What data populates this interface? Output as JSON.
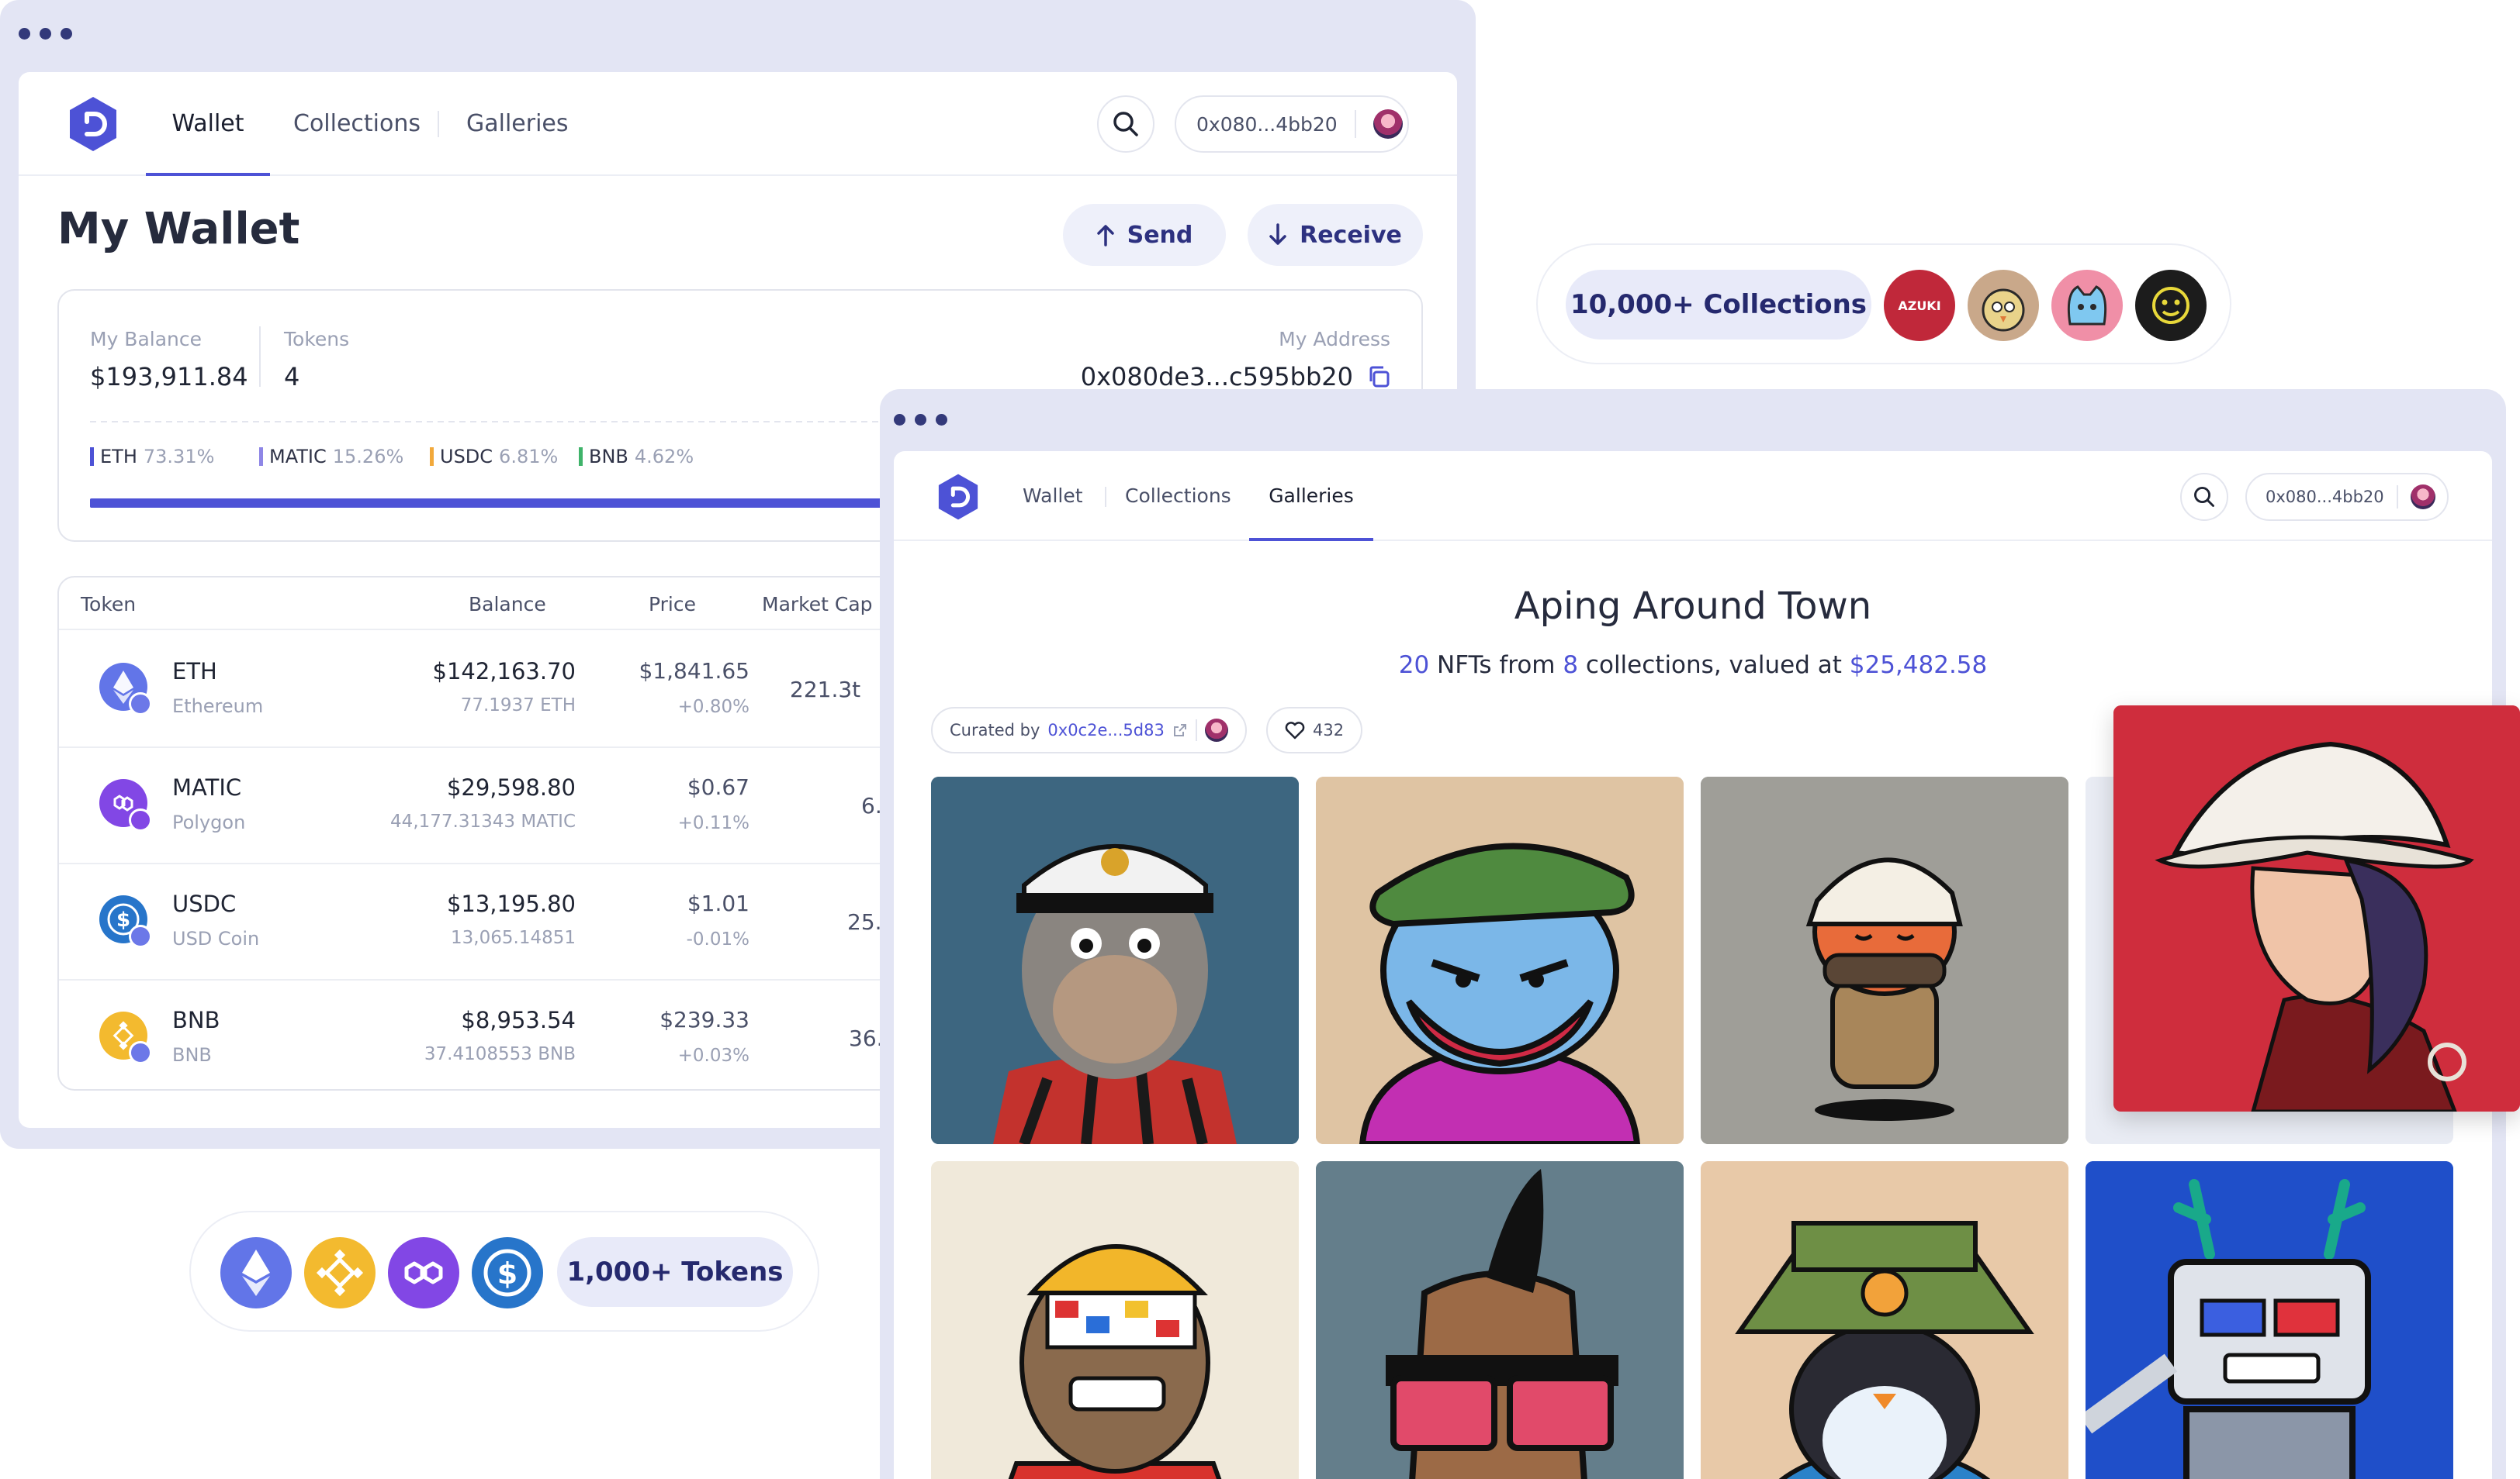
{
  "wallet_window": {
    "nav": {
      "tabs": [
        {
          "label": "Wallet",
          "active": true
        },
        {
          "label": "Collections",
          "active": false
        },
        {
          "label": "Galleries",
          "active": false
        }
      ],
      "address": "0x080...4bb20"
    },
    "title": "My Wallet",
    "actions": {
      "send": "Send",
      "receive": "Receive"
    },
    "summary": {
      "balance_label": "My Balance",
      "balance_value": "$193,911.84",
      "tokens_label": "Tokens",
      "tokens_value": "4",
      "address_label": "My Address",
      "address_value": "0x080de3...c595bb20",
      "allocation": [
        {
          "name": "ETH",
          "percent": "73.31%",
          "color": "#4d52d6"
        },
        {
          "name": "MATIC",
          "percent": "15.26%",
          "color": "#8e86e6"
        },
        {
          "name": "USDC",
          "percent": "6.81%",
          "color": "#f2a93b"
        },
        {
          "name": "BNB",
          "percent": "4.62%",
          "color": "#3fb36a"
        }
      ],
      "allocation_bar": {
        "filled_percent": 73.31
      }
    },
    "table": {
      "headers": {
        "token": "Token",
        "balance": "Balance",
        "price": "Price",
        "market_cap": "Market Cap"
      },
      "rows": [
        {
          "symbol": "ETH",
          "name": "Ethereum",
          "balance_usd": "$142,163.70",
          "balance_token": "77.1937 ETH",
          "price": "$1,841.65",
          "change": "+0.80%",
          "market_cap": "221.3t",
          "icon": "eth-icon",
          "color": "#6275e8"
        },
        {
          "symbol": "MATIC",
          "name": "Polygon",
          "balance_usd": "$29,598.80",
          "balance_token": "44,177.31343 MATIC",
          "price": "$0.67",
          "change": "+0.11%",
          "market_cap": "6.3t",
          "icon": "matic-icon",
          "color": "#8247e5"
        },
        {
          "symbol": "USDC",
          "name": "USD Coin",
          "balance_usd": "$13,195.80",
          "balance_token": "13,065.14851",
          "price": "$1.01",
          "change": "-0.01%",
          "market_cap": "25.9t",
          "icon": "usdc-icon",
          "color": "#2775ca"
        },
        {
          "symbol": "BNB",
          "name": "BNB",
          "balance_usd": "$8,953.54",
          "balance_token": "37.4108553 BNB",
          "price": "$239.33",
          "change": "+0.03%",
          "market_cap": "36.8t",
          "icon": "bnb-icon",
          "color": "#f3ba2f"
        }
      ]
    }
  },
  "collections_badge": {
    "label": "10,000+ Collections",
    "logos": [
      {
        "name": "azuki-logo",
        "text": "AZUKI",
        "color": "#c0283a"
      },
      {
        "name": "bird-pfp-logo",
        "color": "#c9a88a"
      },
      {
        "name": "cool-cat-logo",
        "color": "#f08fa7"
      },
      {
        "name": "smiley-logo",
        "color": "#1c1c1c"
      }
    ]
  },
  "tokens_badge": {
    "label": "1,000+ Tokens",
    "icons": [
      {
        "name": "eth-icon",
        "color": "#6275e8"
      },
      {
        "name": "bnb-icon",
        "color": "#f3ba2f"
      },
      {
        "name": "matic-icon",
        "color": "#8247e5"
      },
      {
        "name": "usdc-icon",
        "color": "#2775ca"
      }
    ]
  },
  "gallery_window": {
    "nav": {
      "tabs": [
        {
          "label": "Wallet",
          "active": false
        },
        {
          "label": "Collections",
          "active": false
        },
        {
          "label": "Galleries",
          "active": true
        }
      ],
      "address": "0x080...4bb20"
    },
    "title": "Aping Around Town",
    "subtitle": {
      "nft_count": "20",
      "text_a": " NFTs from ",
      "collection_count": "8",
      "text_b": " collections, valued at ",
      "value": "$25,482.58"
    },
    "curated": {
      "prefix": "Curated by",
      "address": "0x0c2e...5d83"
    },
    "likes": "432",
    "nfts": [
      {
        "name": "nft-ape-captain",
        "bg": "#3d6680"
      },
      {
        "name": "nft-bird-beret",
        "bg": "#dfc4a3"
      },
      {
        "name": "nft-orange-cap",
        "bg": "#9f9e98"
      },
      {
        "name": "nft-hidden",
        "bg": "#e9ecf4"
      },
      {
        "name": "nft-ape-beanie",
        "bg": "#f0e9da"
      },
      {
        "name": "nft-mohawk",
        "bg": "#647e8b"
      },
      {
        "name": "nft-penguin",
        "bg": "#e8c9a8"
      },
      {
        "name": "nft-robot-deer",
        "bg": "#1f4fc9"
      }
    ],
    "featured_nft": {
      "name": "nft-featured-bucket-hat",
      "bg": "#cf2d3d"
    }
  }
}
